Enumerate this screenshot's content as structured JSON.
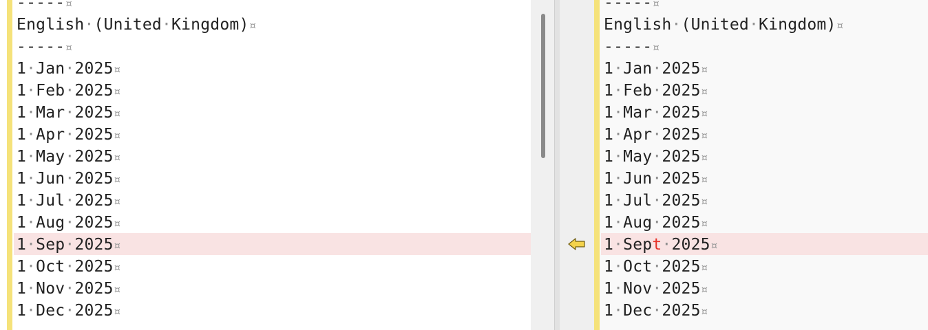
{
  "separator": "-----",
  "header": "English (United Kingdom)",
  "left_lines": [
    "1 Jan 2025",
    "1 Feb 2025",
    "1 Mar 2025",
    "1 Apr 2025",
    "1 May 2025",
    "1 Jun 2025",
    "1 Jul 2025",
    "1 Aug 2025",
    "1 Sep 2025",
    "1 Oct 2025",
    "1 Nov 2025",
    "1 Dec 2025"
  ],
  "right_lines": [
    "1 Jan 2025",
    "1 Feb 2025",
    "1 Mar 2025",
    "1 Apr 2025",
    "1 May 2025",
    "1 Jun 2025",
    "1 Jul 2025",
    "1 Aug 2025",
    "1 Sept 2025",
    "1 Oct 2025",
    "1 Nov 2025",
    "1 Dec 2025"
  ],
  "eol_marker": "¤",
  "diff": {
    "line_index": 8,
    "left_text": "1 Sep 2025",
    "right_text": "1 Sept 2025",
    "changed_char": "t"
  },
  "colors": {
    "gutter_marker": "#f5e27a",
    "diff_highlight": "#f9e3e3",
    "changed_text": "#e6332a",
    "arrow": "#f3d24b"
  },
  "icons": {
    "copy_to_left": "arrow-left-icon"
  }
}
